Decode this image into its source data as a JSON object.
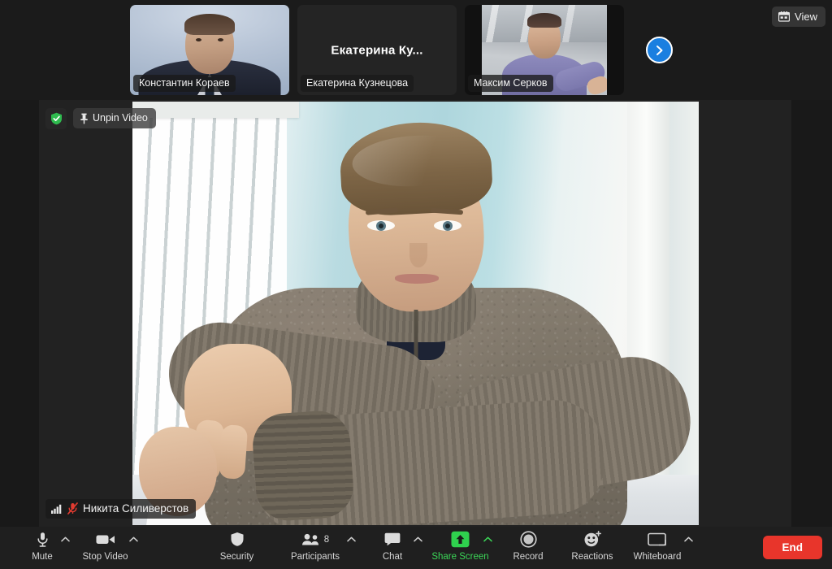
{
  "app": {
    "title": "Zoom Meeting",
    "background_color": "#191919",
    "stage_color": "#222222",
    "toolbar_color": "#1f1f1f"
  },
  "filmstrip": {
    "view_button": {
      "label": "View",
      "icon": "grid-view-icon"
    },
    "next_button": {
      "icon": "chevron-right-icon",
      "color": "#1a7fe0"
    },
    "thumbnails": [
      {
        "name": "Константин Кораев",
        "video_on": true,
        "placeholder_name": ""
      },
      {
        "name": "Екатерина Кузнецова",
        "video_on": false,
        "placeholder_name": "Екатерина Ку..."
      },
      {
        "name": "Максим Серков",
        "video_on": true,
        "placeholder_name": ""
      }
    ]
  },
  "stage": {
    "security_badge": {
      "icon": "shield-check-icon",
      "color": "#3bd657"
    },
    "unpin_button": {
      "label": "Unpin Video",
      "icon": "pin-icon"
    },
    "active_speaker": {
      "name": "Никита Силиверстов",
      "signal_icon": "signal-bars-icon",
      "mute_icon": "microphone-muted-icon",
      "mute_color": "#e8352b"
    }
  },
  "toolbar": {
    "items": [
      {
        "label": "Mute",
        "icon": "microphone-icon",
        "caret": true,
        "accent": false
      },
      {
        "label": "Stop Video",
        "icon": "video-camera-icon",
        "caret": true,
        "accent": false
      },
      {
        "label": "Security",
        "icon": "shield-icon",
        "caret": false,
        "accent": false
      },
      {
        "label": "Participants",
        "icon": "people-icon",
        "caret": true,
        "accent": false,
        "count": "8"
      },
      {
        "label": "Chat",
        "icon": "chat-bubble-icon",
        "caret": true,
        "accent": false
      },
      {
        "label": "Share Screen",
        "icon": "share-screen-icon",
        "caret": true,
        "accent": true
      },
      {
        "label": "Record",
        "icon": "record-icon",
        "caret": false,
        "accent": false
      },
      {
        "label": "Reactions",
        "icon": "reactions-icon",
        "caret": false,
        "accent": false
      },
      {
        "label": "Whiteboard",
        "icon": "whiteboard-icon",
        "caret": true,
        "accent": false
      }
    ],
    "end_button": {
      "label": "End",
      "color": "#e8352b"
    }
  }
}
